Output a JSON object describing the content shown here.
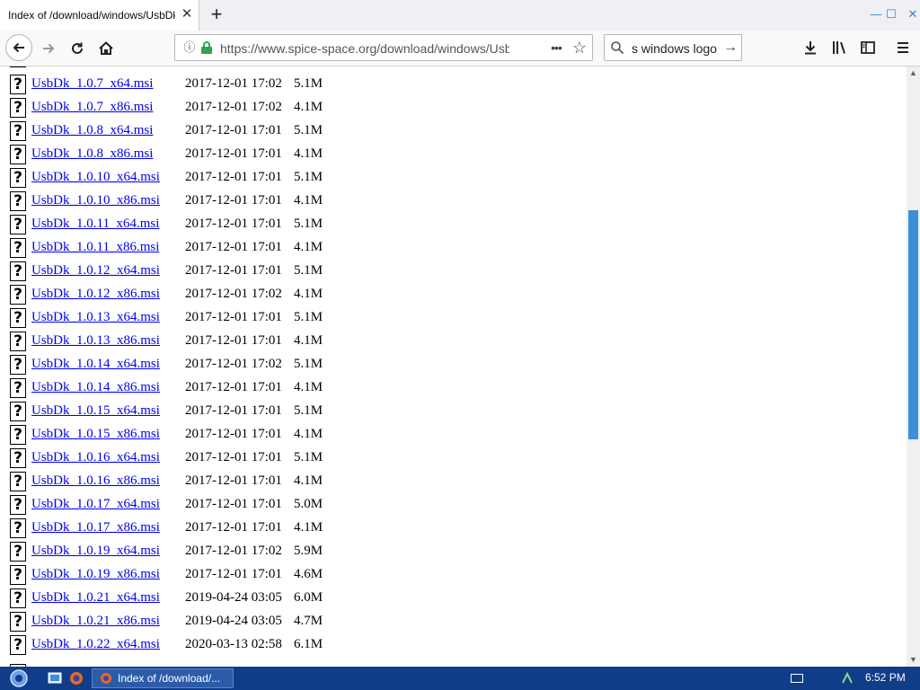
{
  "browser": {
    "tab_title": "Index of /download/windows/UsbDk",
    "tab_close": "✕",
    "new_tab": "+",
    "window_controls": {
      "minimize": "—",
      "maximize": "☐",
      "close": "✕"
    },
    "url": "https://www.spice-space.org/download/windows/UsbDk",
    "search_value": "s windows logo"
  },
  "icons": {
    "back": "back-arrow-icon",
    "forward": "forward-arrow-icon",
    "reload": "reload-icon",
    "home": "home-icon",
    "info": "info-icon",
    "lock": "lock-icon",
    "page_actions": "more-icon",
    "bookmark": "star-icon",
    "search": "search-icon",
    "download": "download-icon",
    "library": "library-icon",
    "sidebar": "sidebar-icon",
    "menu": "hamburger-menu-icon",
    "file": "unknown-file-icon"
  },
  "colors": {
    "link": "#0000ee",
    "lock_green": "#2ea44f",
    "scroll_thumb": "#3c8fd9",
    "taskbar": "#0f3d8a"
  },
  "listing": {
    "file_icon_glyph": "?",
    "rows": [
      {
        "name": "UsbDk_1.0.7_x64.msi",
        "date": "2017-12-01 17:02",
        "size": "5.1M"
      },
      {
        "name": "UsbDk_1.0.7_x86.msi",
        "date": "2017-12-01 17:02",
        "size": "4.1M"
      },
      {
        "name": "UsbDk_1.0.8_x64.msi",
        "date": "2017-12-01 17:01",
        "size": "5.1M"
      },
      {
        "name": "UsbDk_1.0.8_x86.msi",
        "date": "2017-12-01 17:01",
        "size": "4.1M"
      },
      {
        "name": "UsbDk_1.0.10_x64.msi",
        "date": "2017-12-01 17:01",
        "size": "5.1M"
      },
      {
        "name": "UsbDk_1.0.10_x86.msi",
        "date": "2017-12-01 17:01",
        "size": "4.1M"
      },
      {
        "name": "UsbDk_1.0.11_x64.msi",
        "date": "2017-12-01 17:01",
        "size": "5.1M"
      },
      {
        "name": "UsbDk_1.0.11_x86.msi",
        "date": "2017-12-01 17:01",
        "size": "4.1M"
      },
      {
        "name": "UsbDk_1.0.12_x64.msi",
        "date": "2017-12-01 17:01",
        "size": "5.1M"
      },
      {
        "name": "UsbDk_1.0.12_x86.msi",
        "date": "2017-12-01 17:02",
        "size": "4.1M"
      },
      {
        "name": "UsbDk_1.0.13_x64.msi",
        "date": "2017-12-01 17:01",
        "size": "5.1M"
      },
      {
        "name": "UsbDk_1.0.13_x86.msi",
        "date": "2017-12-01 17:01",
        "size": "4.1M"
      },
      {
        "name": "UsbDk_1.0.14_x64.msi",
        "date": "2017-12-01 17:02",
        "size": "5.1M"
      },
      {
        "name": "UsbDk_1.0.14_x86.msi",
        "date": "2017-12-01 17:01",
        "size": "4.1M"
      },
      {
        "name": "UsbDk_1.0.15_x64.msi",
        "date": "2017-12-01 17:01",
        "size": "5.1M"
      },
      {
        "name": "UsbDk_1.0.15_x86.msi",
        "date": "2017-12-01 17:01",
        "size": "4.1M"
      },
      {
        "name": "UsbDk_1.0.16_x64.msi",
        "date": "2017-12-01 17:01",
        "size": "5.1M"
      },
      {
        "name": "UsbDk_1.0.16_x86.msi",
        "date": "2017-12-01 17:01",
        "size": "4.1M"
      },
      {
        "name": "UsbDk_1.0.17_x64.msi",
        "date": "2017-12-01 17:01",
        "size": "5.0M"
      },
      {
        "name": "UsbDk_1.0.17_x86.msi",
        "date": "2017-12-01 17:01",
        "size": "4.1M"
      },
      {
        "name": "UsbDk_1.0.19_x64.msi",
        "date": "2017-12-01 17:02",
        "size": "5.9M"
      },
      {
        "name": "UsbDk_1.0.19_x86.msi",
        "date": "2017-12-01 17:01",
        "size": "4.6M"
      },
      {
        "name": "UsbDk_1.0.21_x64.msi",
        "date": "2019-04-24 03:05",
        "size": "6.0M"
      },
      {
        "name": "UsbDk_1.0.21_x86.msi",
        "date": "2019-04-24 03:05",
        "size": "4.7M"
      },
      {
        "name": "UsbDk_1.0.22_x64.msi",
        "date": "2020-03-13 02:58",
        "size": "6.1M"
      }
    ]
  },
  "taskbar": {
    "task_label": "Index of /download/...",
    "clock": "6:52 PM"
  }
}
